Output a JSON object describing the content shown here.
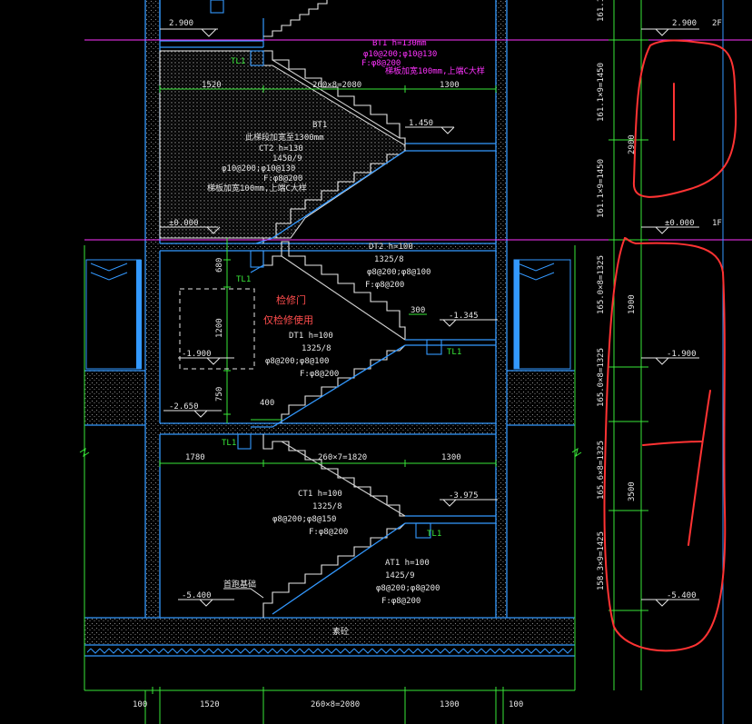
{
  "levels": {
    "l2900": "2.900",
    "l1450": "1.450",
    "l0": "±0.000",
    "lm1345": "-1.345",
    "lm1900": "-1.900",
    "lm2650": "-2.650",
    "lm3975": "-3.975",
    "lm5400": "-5.400"
  },
  "floor_tags": {
    "f2": "2F",
    "f1": "1F"
  },
  "right_levels": {
    "r2900": "2.900",
    "r0": "±0.000",
    "rm1900": "-1.900",
    "rm5400": "-5.400"
  },
  "right_dims": {
    "d2900": "2900",
    "d1900": "1900",
    "d3500": "3500"
  },
  "right_steps": {
    "s_top": "161.1",
    "s1": "161.1×9=1450",
    "s2": "161.1×9=1450",
    "s3": "165.0×8=1325",
    "s4": "165.0×8=1325",
    "s5": "165.6×8=1325",
    "s6": "158.3×9=1425"
  },
  "beams": {
    "tl1_a": "TL1",
    "tl1_b": "TL1",
    "tl1_c": "TL1",
    "tl1_d": "TL1",
    "tl1_e": "TL1",
    "bt1": "BT1"
  },
  "notes": {
    "bt1_l1": "BT1 h=130mm",
    "bt1_l2": "φ10@200;φ10@130",
    "bt1_l3": "F:φ8@200",
    "bt1_l4": "梯板加宽100mm,上端C大样",
    "ct2_l0": "此梯段加宽至1300mm",
    "ct2_l1": "CT2 h=130",
    "ct2_l2": "1450/9",
    "ct2_l3": "φ10@200;φ10@130",
    "ct2_l4": "F:φ8@200",
    "ct2_l5": "梯板加宽100mm,上端C大样",
    "dt2_l1": "DT2 h=100",
    "dt2_l2": "1325/8",
    "dt2_l3": "φ8@200;φ8@100",
    "dt2_l4": "F:φ8@200",
    "dt1_l1": "DT1 h=100",
    "dt1_l2": "1325/8",
    "dt1_l3": "φ8@200;φ8@100",
    "dt1_l4": "F:φ8@200",
    "ct1_l1": "CT1 h=100",
    "ct1_l2": "1325/8",
    "ct1_l3": "φ8@200;φ8@150",
    "ct1_l4": "F:φ8@200",
    "at1_l1": "AT1 h=100",
    "at1_l2": "1425/9",
    "at1_l3": "φ8@200;φ8@200",
    "at1_l4": "F:φ8@200",
    "door1": "检修门",
    "door2": "仅检修使用",
    "fill": "素砼",
    "anchor": "首跑基础"
  },
  "dims": {
    "d1520a": "1520",
    "d2080a": "260×8=2080",
    "d1300a": "1300",
    "d1780": "1780",
    "d1820": "260×7=1820",
    "d1300b": "1300",
    "v680": "680",
    "v1200": "1200",
    "v750": "750",
    "h300": "300",
    "h400": "400",
    "b100a": "100",
    "b1520": "1520",
    "b2080": "260×8=2080",
    "b1300": "1300",
    "b100b": "100"
  },
  "colors": {
    "background": "#000000",
    "wall": "#3399ff",
    "dim": "#39e639",
    "text": "#e6e6e6",
    "level_line": "#ff33ff",
    "markup": "#ff3333"
  }
}
